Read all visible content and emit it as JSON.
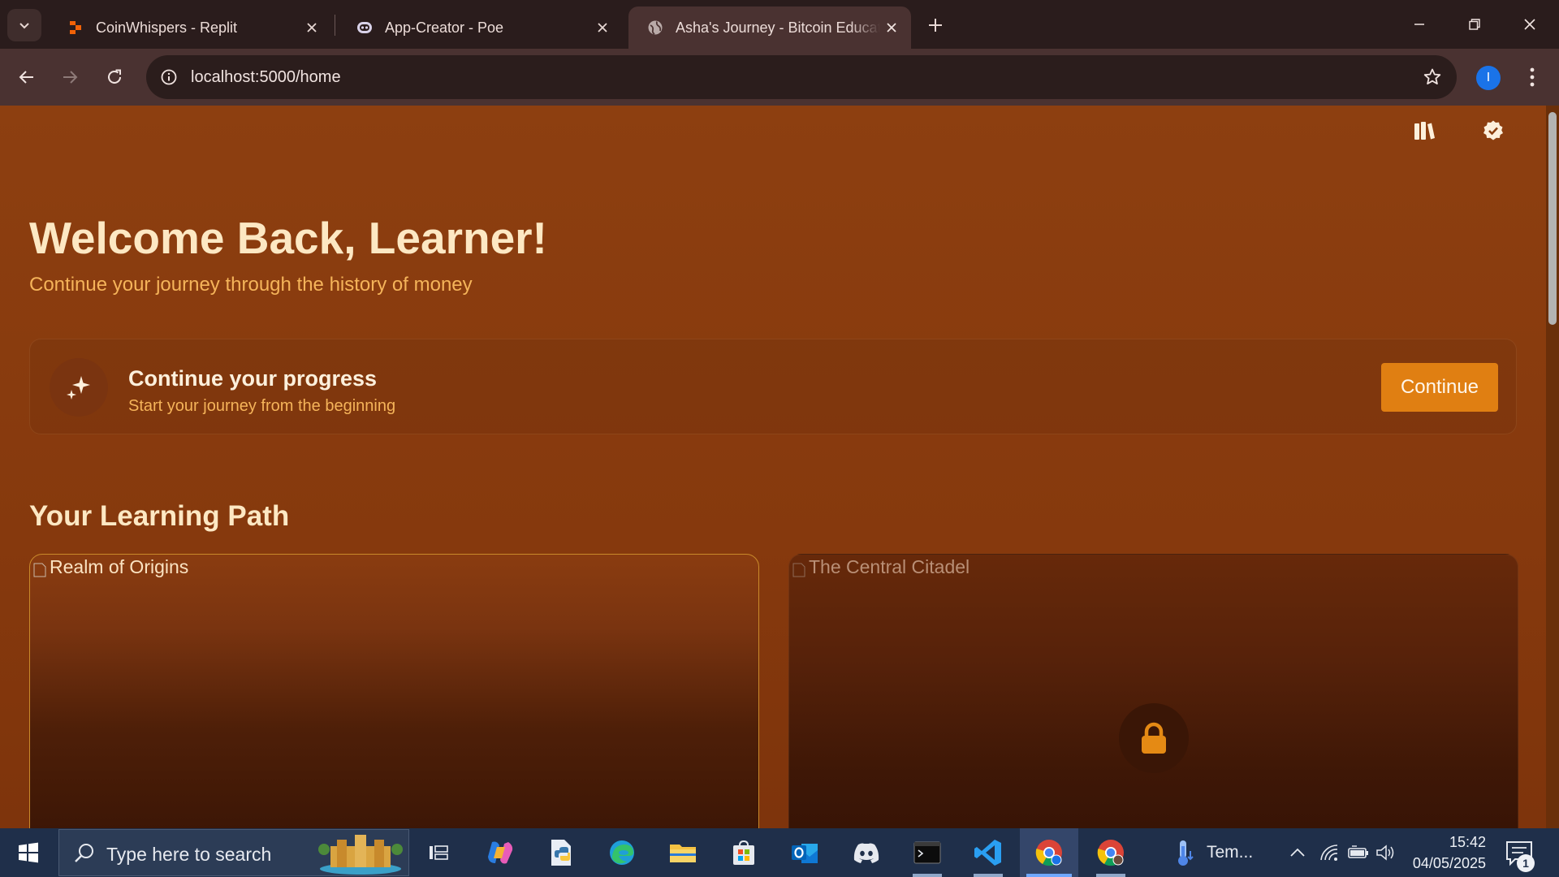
{
  "browser": {
    "tabs": [
      {
        "title": "CoinWhispers - Replit",
        "icon": "replit-icon"
      },
      {
        "title": "App-Creator - Poe",
        "icon": "poe-icon"
      },
      {
        "title": "Asha's Journey - Bitcoin Education",
        "icon": "globe-icon",
        "active": true
      }
    ],
    "url": "localhost:5000/home",
    "profile_initial": "I"
  },
  "page": {
    "hero": {
      "title": "Welcome Back, Learner!",
      "subtitle": "Continue your journey through the history of money"
    },
    "progress_card": {
      "title": "Continue your progress",
      "subtitle": "Start your journey from the beginning",
      "button": "Continue"
    },
    "learning_path": {
      "title": "Your Learning Path",
      "realms": [
        {
          "alt": "Realm of Origins",
          "locked": false
        },
        {
          "alt": "The Central Citadel",
          "locked": true
        }
      ]
    }
  },
  "taskbar": {
    "search_placeholder": "Type here to search",
    "weather_text": "Tem...",
    "time": "15:42",
    "date": "04/05/2025",
    "notification_count": "1"
  },
  "colors": {
    "page_bg": "#8a3e0f",
    "accent_button": "#e07f12",
    "heading": "#fde8c3",
    "subtitle": "#f5b45a"
  }
}
